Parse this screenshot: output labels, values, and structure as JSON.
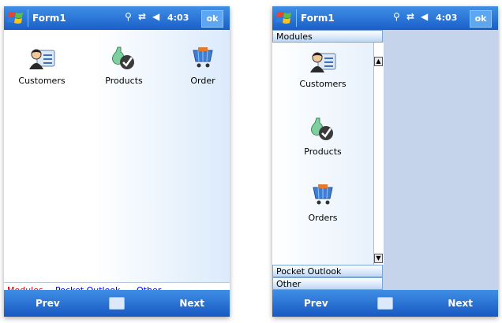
{
  "left_screen": {
    "title": "Form1",
    "time": "4:03",
    "ok_label": "ok",
    "icons": [
      {
        "label": "Customers",
        "icon": "customers-icon"
      },
      {
        "label": "Products",
        "icon": "products-icon"
      },
      {
        "label": "Order",
        "icon": "order-cart-icon"
      }
    ],
    "tabs": [
      {
        "label": "Modules",
        "active": true
      },
      {
        "label": "Pocket Outlook",
        "active": false
      },
      {
        "label": "Other",
        "active": false
      }
    ],
    "softkeys": {
      "left": "Prev",
      "right": "Next"
    }
  },
  "right_screen": {
    "title": "Form1",
    "time": "4:03",
    "ok_label": "ok",
    "sections": {
      "modules": "Modules",
      "pocket_outlook": "Pocket Outlook",
      "other": "Other"
    },
    "items": [
      {
        "label": "Customers",
        "icon": "customers-icon"
      },
      {
        "label": "Products",
        "icon": "products-icon"
      },
      {
        "label": "Orders",
        "icon": "order-cart-icon"
      }
    ],
    "softkeys": {
      "left": "Prev",
      "right": "Next"
    }
  },
  "colors": {
    "titlebar": "#1a5fc9",
    "active_tab": "#cc0000",
    "link": "#0000ee"
  }
}
